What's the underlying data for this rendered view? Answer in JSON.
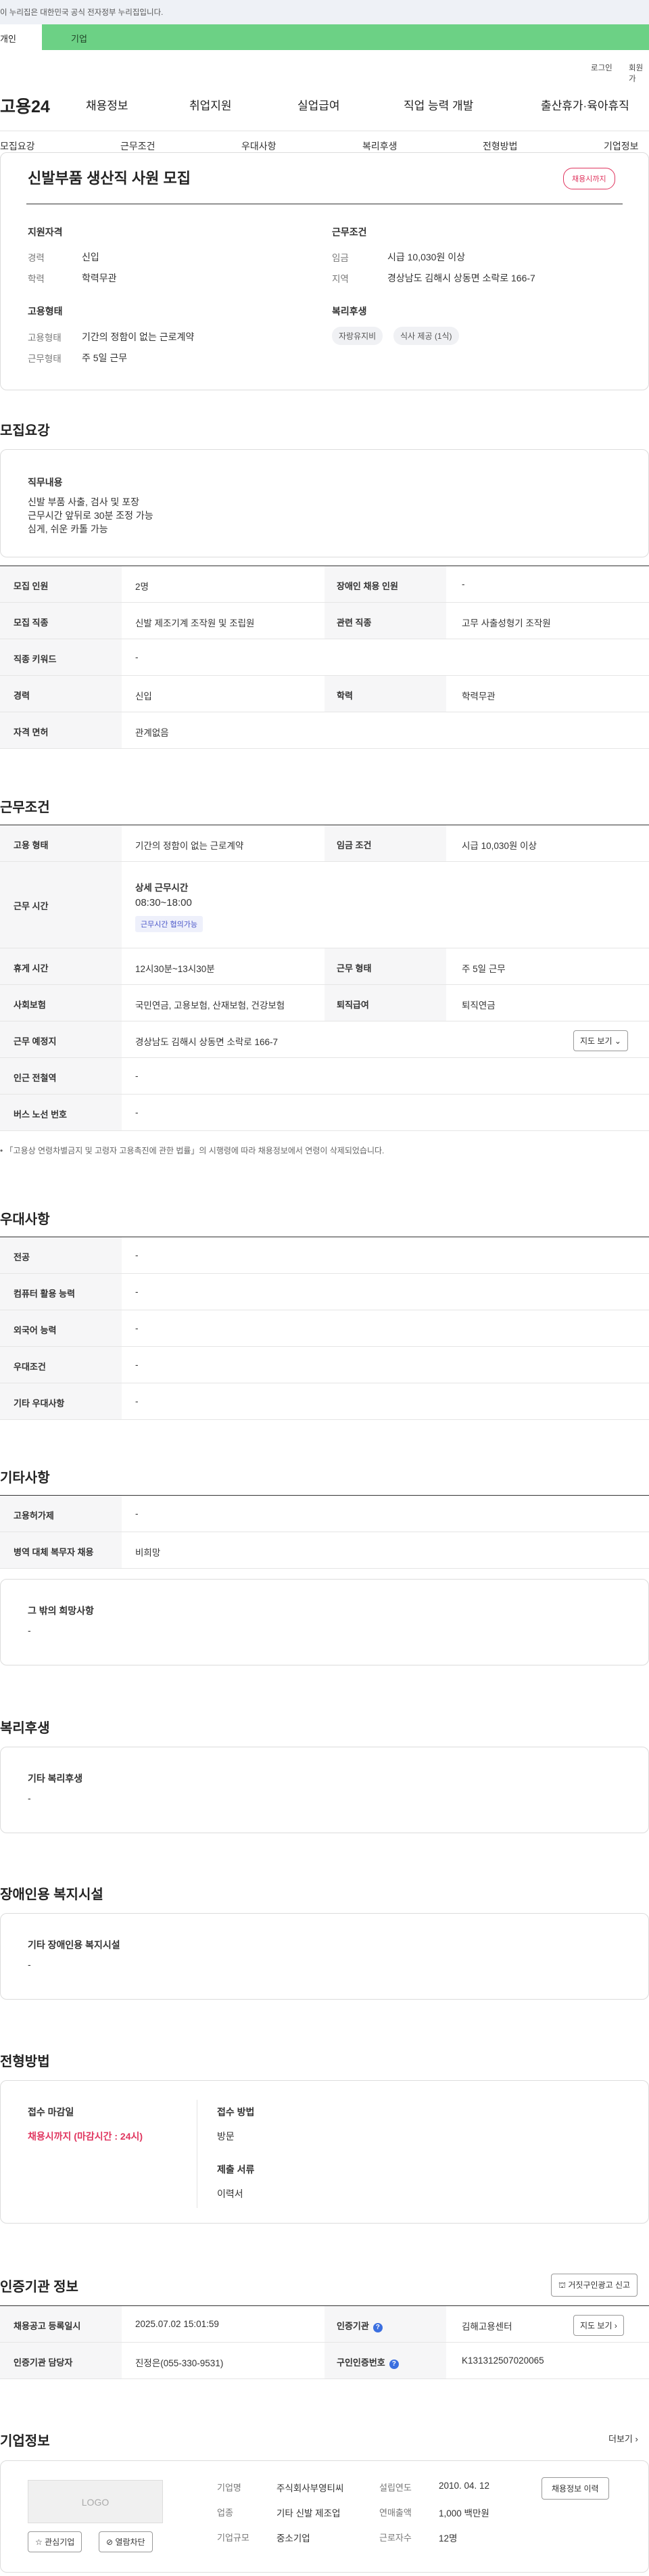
{
  "gov_banner": "이 누리집은 대한민국 공식 전자정부 누리집입니다.",
  "top_tabs": {
    "personal": "개인",
    "company": "기업"
  },
  "util": {
    "login": "로그인",
    "join": "회원가"
  },
  "logo": "고용24",
  "main_nav": [
    "채용정보",
    "취업지원",
    "실업급여",
    "직업 능력 개발",
    "출산휴가·육아휴직"
  ],
  "sub_nav": [
    "모집요강",
    "근무조건",
    "우대사항",
    "복리후생",
    "전형방법",
    "기업정보"
  ],
  "summary": {
    "title": "신발부품 생산직 사원 모집",
    "badge": "채용시까지",
    "qual_head": "지원자격",
    "career_lbl": "경력",
    "career_val": "신입",
    "edu_lbl": "학력",
    "edu_val": "학력무관",
    "cond_head": "근무조건",
    "wage_lbl": "임금",
    "wage_val": "시급 10,030원 이상",
    "area_lbl": "지역",
    "area_val": "경상남도 김해시 상동면 소락로 166-7",
    "emp_head": "고용형태",
    "emptype_lbl": "고용형태",
    "emptype_val": "기간의 정함이 없는 근로계약",
    "worktype_lbl": "근무형태",
    "worktype_val": "주 5일 근무",
    "welfare_head": "복리후생",
    "welfare_pills": [
      "자랑유지비",
      "식사 제공 (1식)"
    ]
  },
  "recruit": {
    "title": "모집요강",
    "duty_head": "직무내용",
    "duty_lines": [
      "신발 부품 사출, 검사 및 포장",
      "근무시간 앞뒤로 30분 조정 가능",
      "심게, 쉬운 카톨 가능"
    ],
    "rows": [
      {
        "l1": "모집 인원",
        "v1": "2명",
        "l2": "장애인 채용 인원",
        "v2": "-"
      },
      {
        "l1": "모집 직종",
        "v1": "신발 제조기계 조작원 및 조립원",
        "l2": "관련 직종",
        "v2": "고무 사출성형기 조작원"
      },
      {
        "l1": "직종 키워드",
        "v1": "-"
      },
      {
        "l1": "경력",
        "v1": "신입",
        "l2": "학력",
        "v2": "학력무관"
      },
      {
        "l1": "자격 면허",
        "v1": "관계없음"
      }
    ]
  },
  "work": {
    "title": "근무조건",
    "r1": {
      "l1": "고용 형태",
      "v1": "기간의 정함이 없는 근로계약",
      "l2": "임금 조건",
      "v2": "시급 10,030원 이상"
    },
    "hours": {
      "lbl": "근무 시간",
      "detail_head": "상세 근무시간",
      "time": "08:30~18:00",
      "tag": "근무시간 협의가능"
    },
    "r3": {
      "l1": "휴게 시간",
      "v1": "12시30분~13시30분",
      "l2": "근무 형태",
      "v2": "주 5일 근무"
    },
    "r4": {
      "l1": "사회보험",
      "v1": "국민연금, 고용보험, 산재보험, 건강보험",
      "l2": "퇴직급여",
      "v2": "퇴직연금"
    },
    "r5": {
      "l1": "근무 예정지",
      "v1": "경상남도 김해시 상동면 소락로 166-7",
      "btn": "지도 보기"
    },
    "r6": {
      "l1": "인근 전철역",
      "v1": "-"
    },
    "r7": {
      "l1": "버스 노선 번호",
      "v1": "-"
    },
    "note": "「고용상 연령차별금지 및 고령자 고용촉진에 관한 법률」의 시행령에 따라 채용정보에서 연령이 삭제되었습니다."
  },
  "pref": {
    "title": "우대사항",
    "rows": [
      {
        "l": "전공",
        "v": "-"
      },
      {
        "l": "컴퓨터 활용 능력",
        "v": "-"
      },
      {
        "l": "외국어 능력",
        "v": "-"
      },
      {
        "l": "우대조건",
        "v": "-"
      },
      {
        "l": "기타 우대사항",
        "v": "-"
      }
    ]
  },
  "etc": {
    "title": "기타사항",
    "rows": [
      {
        "l": "고용허가제",
        "v": "-"
      },
      {
        "l": "병역 대체 복무자 채용",
        "v": "비희망"
      }
    ],
    "box_head": "그 밖의 희망사항",
    "box_val": "-"
  },
  "welfare": {
    "title": "복리후생",
    "box_head": "기타 복리후생",
    "box_val": "-"
  },
  "disab": {
    "title": "장애인용 복지시설",
    "box_head": "기타 장애인용 복지시설",
    "box_val": "-"
  },
  "process": {
    "title": "전형방법",
    "deadline_head": "접수 마감일",
    "deadline_val": "채용시까지 (마감시간 : 24시)",
    "method_head": "접수 방법",
    "method_val": "방문",
    "docs_head": "제출 서류",
    "docs_val": "이력서"
  },
  "agency": {
    "title": "인증기관 정보",
    "report_btn": "거짓구인광고 신고",
    "r1": {
      "l1": "채용공고 등록일시",
      "v1": "2025.07.02 15:01:59",
      "l2": "인증기관",
      "v2": "김해고용센터",
      "btn": "지도 보기"
    },
    "r2": {
      "l1": "인증기관 담당자",
      "v1": "진정은(055-330-9531)",
      "l2": "구인인증번호",
      "v2": "K131312507020065"
    }
  },
  "company": {
    "title": "기업정보",
    "more": "더보기",
    "logo": "LOGO",
    "fav_btn": "관심기업",
    "block_btn": "열람차단",
    "history_btn": "채용정보 이력",
    "fields": {
      "name_l": "기업명",
      "name_v": "주식회사부영티씨",
      "ind_l": "업종",
      "ind_v": "기타 신발 제조업",
      "size_l": "기업규모",
      "size_v": "중소기업",
      "est_l": "설립연도",
      "est_v": "2010. 04. 12",
      "rev_l": "연매출액",
      "rev_v": "1,000 백만원",
      "emp_l": "근로자수",
      "emp_v": "12명"
    }
  }
}
